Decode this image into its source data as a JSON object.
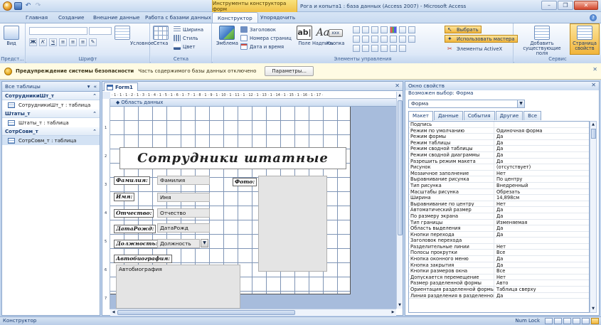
{
  "window": {
    "title": "Рога и копыта1 : база данных (Access 2007) - Microsoft Access",
    "context_tab_header": "Инструменты конструктора форм",
    "controls": [
      "–",
      "❐",
      "✕"
    ]
  },
  "ribbon_tabs": [
    {
      "label": "Главная",
      "active": false
    },
    {
      "label": "Создание",
      "active": false
    },
    {
      "label": "Внешние данные",
      "active": false
    },
    {
      "label": "Работа с базами данных",
      "active": false
    },
    {
      "label": "Конструктор",
      "active": true
    },
    {
      "label": "Упорядочить",
      "active": false
    }
  ],
  "ribbon": {
    "groups": {
      "views": {
        "label": "Предст...",
        "button": "Вид"
      },
      "font": {
        "label": "Шрифт",
        "conditional": "Условное"
      },
      "grid": {
        "label": "Сетка",
        "grid_btn": "Сетка",
        "thickness": "Ширина",
        "style": "Стиль",
        "color": "Цвет"
      },
      "controls": {
        "label": "Элементы управления",
        "logo": "Эмблема",
        "title": "Заголовок",
        "page_numbers": "Номера страниц",
        "date_time": "Дата и время",
        "field": "Поле",
        "label_ctl": "Надпись",
        "button": "Кнопка",
        "select": "Выбрать",
        "use_wizard": "Использовать мастера",
        "activex": "Элементы ActiveX"
      },
      "tools": {
        "label": "Сервис",
        "add_fields": "Добавить существующие поля",
        "property_sheet": "Страница свойств"
      }
    }
  },
  "security": {
    "title": "Предупреждение системы безопасности",
    "message": "Часть содержимого базы данных отключено",
    "button": "Параметры..."
  },
  "nav": {
    "header": "Все таблицы",
    "groups": [
      {
        "name": "СотрудникиШт_т",
        "items": [
          "СотрудникиШт_т : таблица"
        ]
      },
      {
        "name": "Штаты_т",
        "items": [
          "Штаты_т : таблица"
        ]
      },
      {
        "name": "СотрСовм_т",
        "items": [
          "СотрСовм_т : таблица"
        ]
      }
    ]
  },
  "document": {
    "tab": "Form1",
    "section": "Область данных",
    "ruler_marks": "· 1 · 1 · 1 · 2 · 1 · 3 · 1 · 4 · 1 · 5 · 1 · 6 · 1 · 7 · 1 · 8 · 1 · 9 · 1 · 10 · 1 · 11 · 1 · 12 · 1 · 13 · 1 · 14 · 1 · 15 · 1 · 16 · 1 · 17 ·",
    "vruler_marks": [
      "1",
      "2",
      "3",
      "4",
      "5",
      "6",
      "7"
    ],
    "form": {
      "title": "Сотрудники штатные",
      "labels": {
        "surname": "Фамилия:",
        "name": "Имя:",
        "patronymic": "Отчество:",
        "birthdate": "ДатаРожд:",
        "position": "Должность:",
        "biography": "Автобиография:",
        "photo": "Фото:"
      },
      "fields": {
        "surname": "Фамилия",
        "name": "Имя",
        "patronymic": "Отчество",
        "birthdate": "ДатаРожд",
        "position": "Должность",
        "biography": "Автобиография"
      }
    }
  },
  "property_sheet": {
    "header": "Окно свойств",
    "subtitle": "Возможен выбор: Форма",
    "selector": "Форма",
    "tabs": [
      {
        "label": "Макет",
        "active": true
      },
      {
        "label": "Данные",
        "active": false
      },
      {
        "label": "События",
        "active": false
      },
      {
        "label": "Другие",
        "active": false
      },
      {
        "label": "Все",
        "active": false
      }
    ],
    "rows": [
      [
        "Подпись",
        ""
      ],
      [
        "Режим по умолчанию",
        "Одиночная форма"
      ],
      [
        "Режим формы",
        "Да"
      ],
      [
        "Режим таблицы",
        "Да"
      ],
      [
        "Режим сводной таблицы",
        "Да"
      ],
      [
        "Режим сводной диаграммы",
        "Да"
      ],
      [
        "Разрешить режим макета",
        "Да"
      ],
      [
        "Рисунок",
        "(отсутствует)"
      ],
      [
        "Мозаичное заполнение",
        "Нет"
      ],
      [
        "Выравнивание рисунка",
        "По центру"
      ],
      [
        "Тип рисунка",
        "Внедренный"
      ],
      [
        "Масштабы рисунка",
        "Обрезать"
      ],
      [
        "Ширина",
        "14,898см"
      ],
      [
        "Выравнивание по центру",
        "Нет"
      ],
      [
        "Автоматический размер",
        "Да"
      ],
      [
        "По размеру экрана",
        "Да"
      ],
      [
        "Тип границы",
        "Изменяемая"
      ],
      [
        "Область выделения",
        "Да"
      ],
      [
        "Кнопки перехода",
        "Да"
      ],
      [
        "Заголовок перехода",
        ""
      ],
      [
        "Разделительные линии",
        "Нет"
      ],
      [
        "Полосы прокрутки",
        "Все"
      ],
      [
        "Кнопка оконного меню",
        "Да"
      ],
      [
        "Кнопка закрытия",
        "Да"
      ],
      [
        "Кнопки размеров окна",
        "Все"
      ],
      [
        "Допускается перемещение",
        "Нет"
      ],
      [
        "Размер разделенной формы",
        "Авто"
      ],
      [
        "Ориентация разделенной формы",
        "Таблица сверху"
      ],
      [
        "Линия разделения в разделенной ф",
        "Да"
      ]
    ]
  },
  "status": {
    "left": "Конструктор",
    "numlock": "Num Lock"
  },
  "colors": {
    "accent": "#f0c248",
    "ribbon": "#d3e2f5",
    "grid_line": "#7f95b6"
  }
}
